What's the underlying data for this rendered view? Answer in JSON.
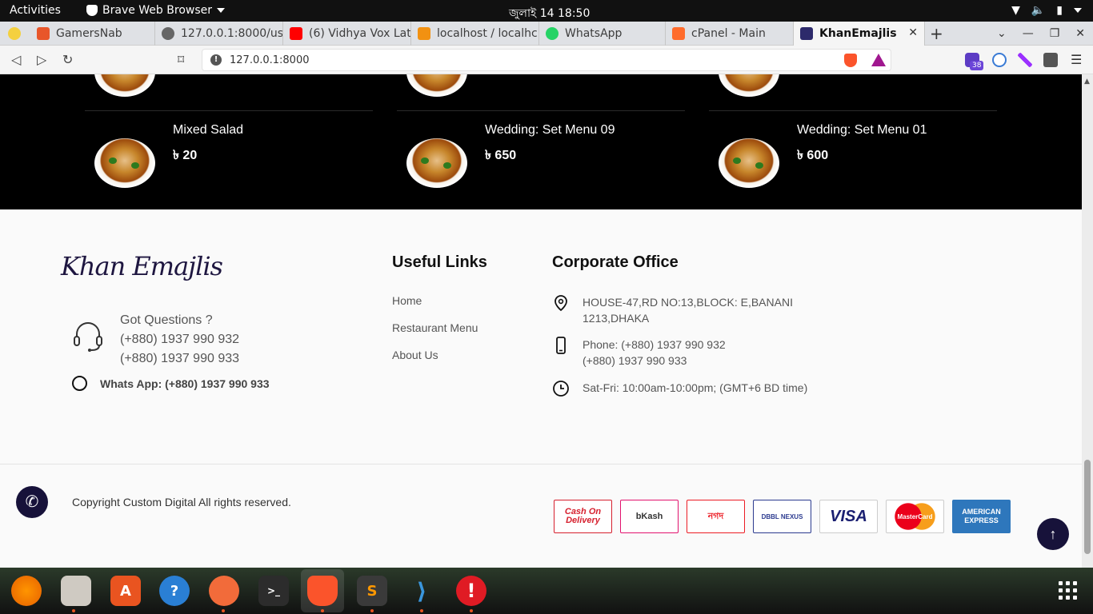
{
  "topbar": {
    "activities": "Activities",
    "app_name": "Brave Web Browser",
    "clock": "জুলাই 14  18:50"
  },
  "tabs": [
    {
      "title": "GamersNab",
      "favicon_color": "#e8562a"
    },
    {
      "title": "127.0.0.1:8000/use",
      "favicon_color": "#666666"
    },
    {
      "title": "(6) Vidhya Vox Lat",
      "favicon_color": "#ff0000"
    },
    {
      "title": "localhost / localhc",
      "favicon_color": "#f29111"
    },
    {
      "title": "WhatsApp",
      "favicon_color": "#25d366"
    },
    {
      "title": "cPanel - Main",
      "favicon_color": "#ff6c2c"
    },
    {
      "title": "KhanEmajlis",
      "favicon_color": "#2d2a6b",
      "active": true
    }
  ],
  "address": {
    "url": "127.0.0.1:8000",
    "extension_badge": "38"
  },
  "menu_items": [
    {
      "name": "Mixed Salad",
      "price": "৳ 20"
    },
    {
      "name": "Wedding: Set Menu 09",
      "price": "৳ 650"
    },
    {
      "name": "Wedding: Set Menu 01",
      "price": "৳ 600"
    }
  ],
  "footer": {
    "logo_text": "Khan Emajlis",
    "questions": {
      "label": "Got Questions ?",
      "phone1": "(+880) 1937 990 932",
      "phone2": "(+880) 1937 990 933"
    },
    "whatsapp": "Whats App: (+880) 1937 990 933",
    "useful_links": {
      "title": "Useful Links",
      "items": [
        "Home",
        "Restaurant Menu",
        "About Us"
      ]
    },
    "office": {
      "title": "Corporate Office",
      "address_line1": "HOUSE-47,RD NO:13,BLOCK: E,BANANI",
      "address_line2": "1213,DHAKA",
      "phone_line1": "Phone: (+880) 1937 990 932",
      "phone_line2": "(+880) 1937 990 933",
      "hours": "Sat-Fri: 10:00am-10:00pm; (GMT+6 BD time)"
    },
    "copyright": "Copyright Custom Digital  All rights reserved.",
    "payments": [
      {
        "label": "Cash On Delivery",
        "color": "#d6202e"
      },
      {
        "label": "bKash",
        "color": "#e2136e"
      },
      {
        "label": "নগদ",
        "color": "#ec1c24"
      },
      {
        "label": "DBBL NEXUS",
        "color": "#2b3a8f"
      },
      {
        "label": "VISA",
        "color": "#1a1f71"
      },
      {
        "label": "MasterCard",
        "color": "#eb001b"
      },
      {
        "label": "AMERICAN EXPRESS",
        "color": "#2e77bc"
      }
    ]
  },
  "colors": {
    "brand_navy": "#17123a",
    "menu_bg": "#000000",
    "footer_bg": "#fafafa"
  }
}
